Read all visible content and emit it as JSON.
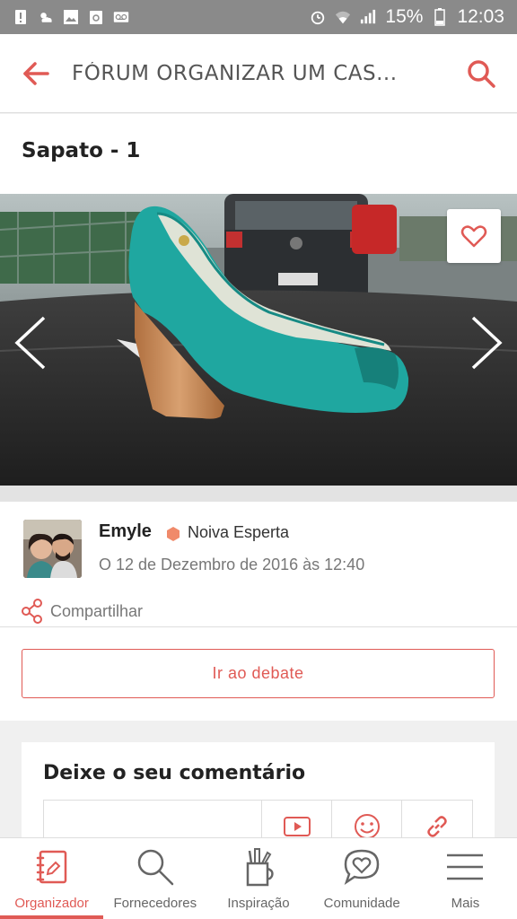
{
  "status_bar": {
    "battery": "15%",
    "time": "12:03"
  },
  "app_bar": {
    "title": "FÓRUM ORGANIZAR UM CAS..."
  },
  "post": {
    "title": "Sapato - 1"
  },
  "author": {
    "name": "Emyle",
    "badge": "Noiva Esperta",
    "date": "O 12 de Dezembro de 2016 às 12:40"
  },
  "share": {
    "label": "Compartilhar"
  },
  "debate_button": {
    "label": "Ir ao debate"
  },
  "comment": {
    "title": "Deixe o seu comentário"
  },
  "bottom_nav": {
    "items": [
      {
        "label": "Organizador",
        "icon": "notebook-icon",
        "active": true
      },
      {
        "label": "Fornecedores",
        "icon": "search-icon",
        "active": false
      },
      {
        "label": "Inspiração",
        "icon": "pencil-cup-icon",
        "active": false
      },
      {
        "label": "Comunidade",
        "icon": "heart-chat-icon",
        "active": false
      },
      {
        "label": "Mais",
        "icon": "menu-icon",
        "active": false
      }
    ]
  },
  "colors": {
    "accent": "#e05a55",
    "status_bar": "#8a8a8a",
    "badge": "#f08a6a"
  }
}
